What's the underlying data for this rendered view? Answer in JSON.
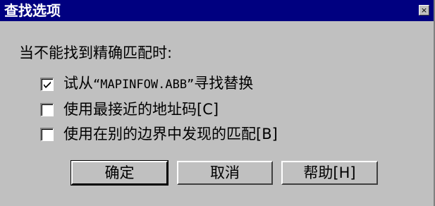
{
  "window": {
    "title": "查找选项",
    "close_glyph": "×"
  },
  "prompt": "当不能找到精确匹配时:",
  "options": [
    {
      "label_prefix": "试从",
      "label_code": "“MAPINFOW.ABB”",
      "label_suffix": "寻找替换",
      "checked": true
    },
    {
      "label": "使用最接近的地址码[C]",
      "checked": false
    },
    {
      "label": "使用在别的边界中发现的匹配[B]",
      "checked": false
    }
  ],
  "buttons": {
    "ok": "确定",
    "cancel": "取消",
    "help": "帮助[H]"
  },
  "colors": {
    "titlebar": "#000080",
    "face": "#c0c0c0"
  }
}
